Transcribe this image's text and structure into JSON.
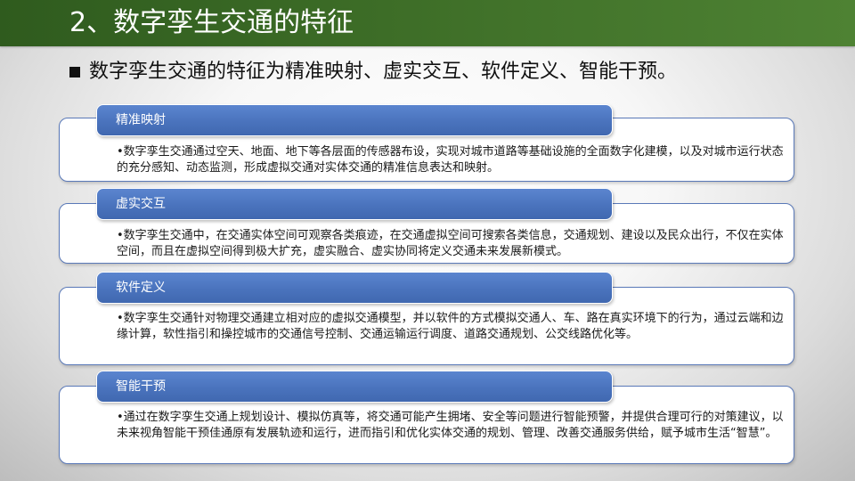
{
  "header": {
    "title": "2、数字孪生交通的特征"
  },
  "intro": {
    "text": "数字孪生交通的特征为精准映射、虚实交互、软件定义、智能干预。"
  },
  "sections": [
    {
      "label": "精准映射",
      "body": "•数字孪生交通通过空天、地面、地下等各层面的传感器布设，实现对城市道路等基础设施的全面数字化建模，以及对城市运行状态的充分感知、动态监测，形成虚拟交通对实体交通的精准信息表达和映射。"
    },
    {
      "label": "虚实交互",
      "body": "•数字孪生交通中，在交通实体空间可观察各类痕迹，在交通虚拟空间可搜索各类信息，交通规划、建设以及民众出行，不仅在实体空间，而且在虚拟空间得到极大扩充，虚实融合、虚实协同将定义交通未来发展新模式。"
    },
    {
      "label": "软件定义",
      "body": "•数字孪生交通针对物理交通建立相对应的虚拟交通模型，并以软件的方式模拟交通人、车、路在真实环境下的行为，通过云端和边缘计算，软性指引和操控城市的交通信号控制、交通运输运行调度、道路交通规划、公交线路优化等。"
    },
    {
      "label": "智能干预",
      "body": "•通过在数字孪生交通上规划设计、模拟仿真等，将交通可能产生拥堵、安全等问题进行智能预警，并提供合理可行的对策建议，以未来视角智能干预佳通原有发展轨迹和运行，进而指引和优化实体交通的规划、管理、改善交通服务供给，赋予城市生活“智慧”。"
    }
  ],
  "colors": {
    "title_bar": "#3d6d27",
    "pill": "#4a73bd",
    "box_border": "#5a79b8"
  }
}
